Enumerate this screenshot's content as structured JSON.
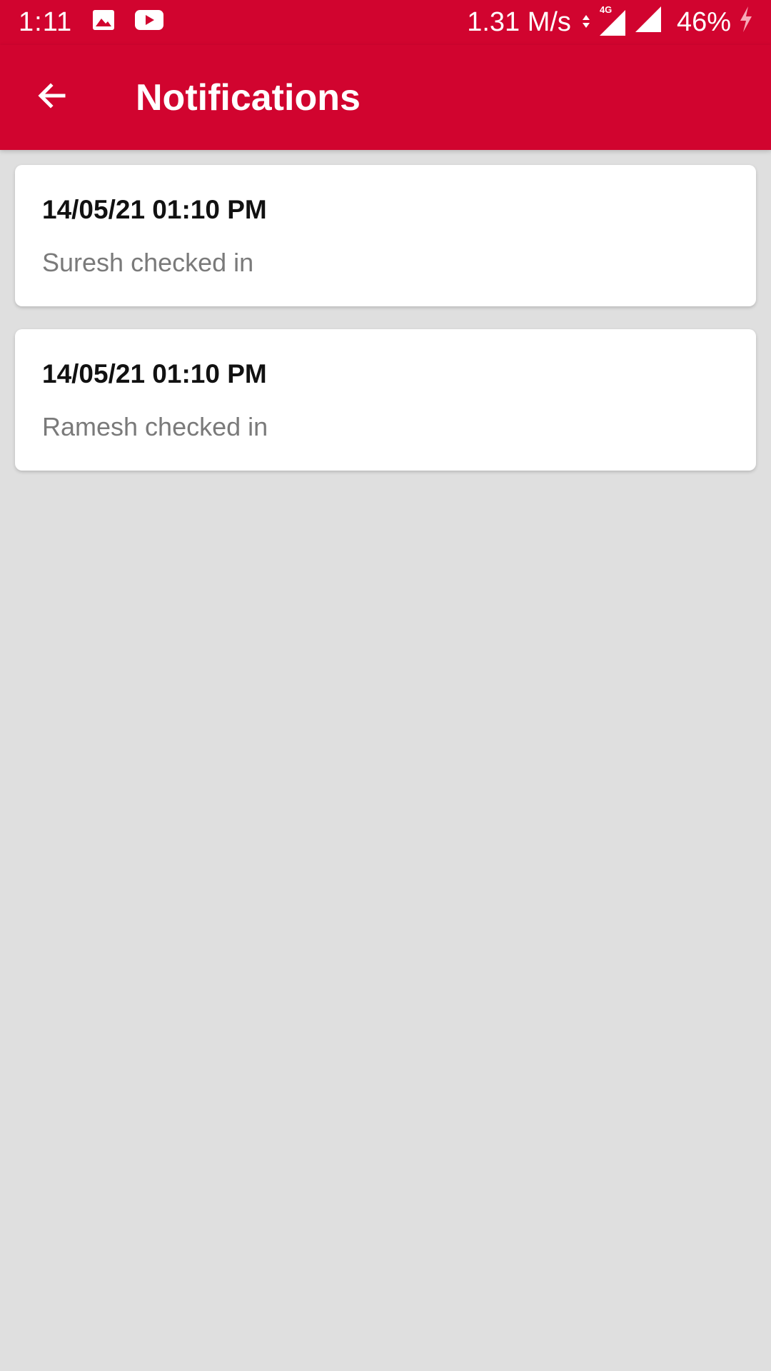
{
  "status_bar": {
    "time": "1:11",
    "network_speed": "1.31 M/s",
    "network_type": "4G",
    "battery": "46%",
    "icons": [
      "image-icon",
      "youtube-icon",
      "data-arrows-icon",
      "signal-icon",
      "signal-icon",
      "charging-icon"
    ]
  },
  "app_bar": {
    "title": "Notifications",
    "back_icon": "back-arrow-icon"
  },
  "notifications": [
    {
      "date": "14/05/21 01:10 PM",
      "message": "Suresh checked in"
    },
    {
      "date": "14/05/21 01:10 PM",
      "message": "Ramesh checked in"
    }
  ],
  "colors": {
    "primary": "#d1042f",
    "background": "#dfdfdf",
    "card": "#ffffff",
    "date_text": "#111111",
    "message_text": "#7a7a7a"
  }
}
